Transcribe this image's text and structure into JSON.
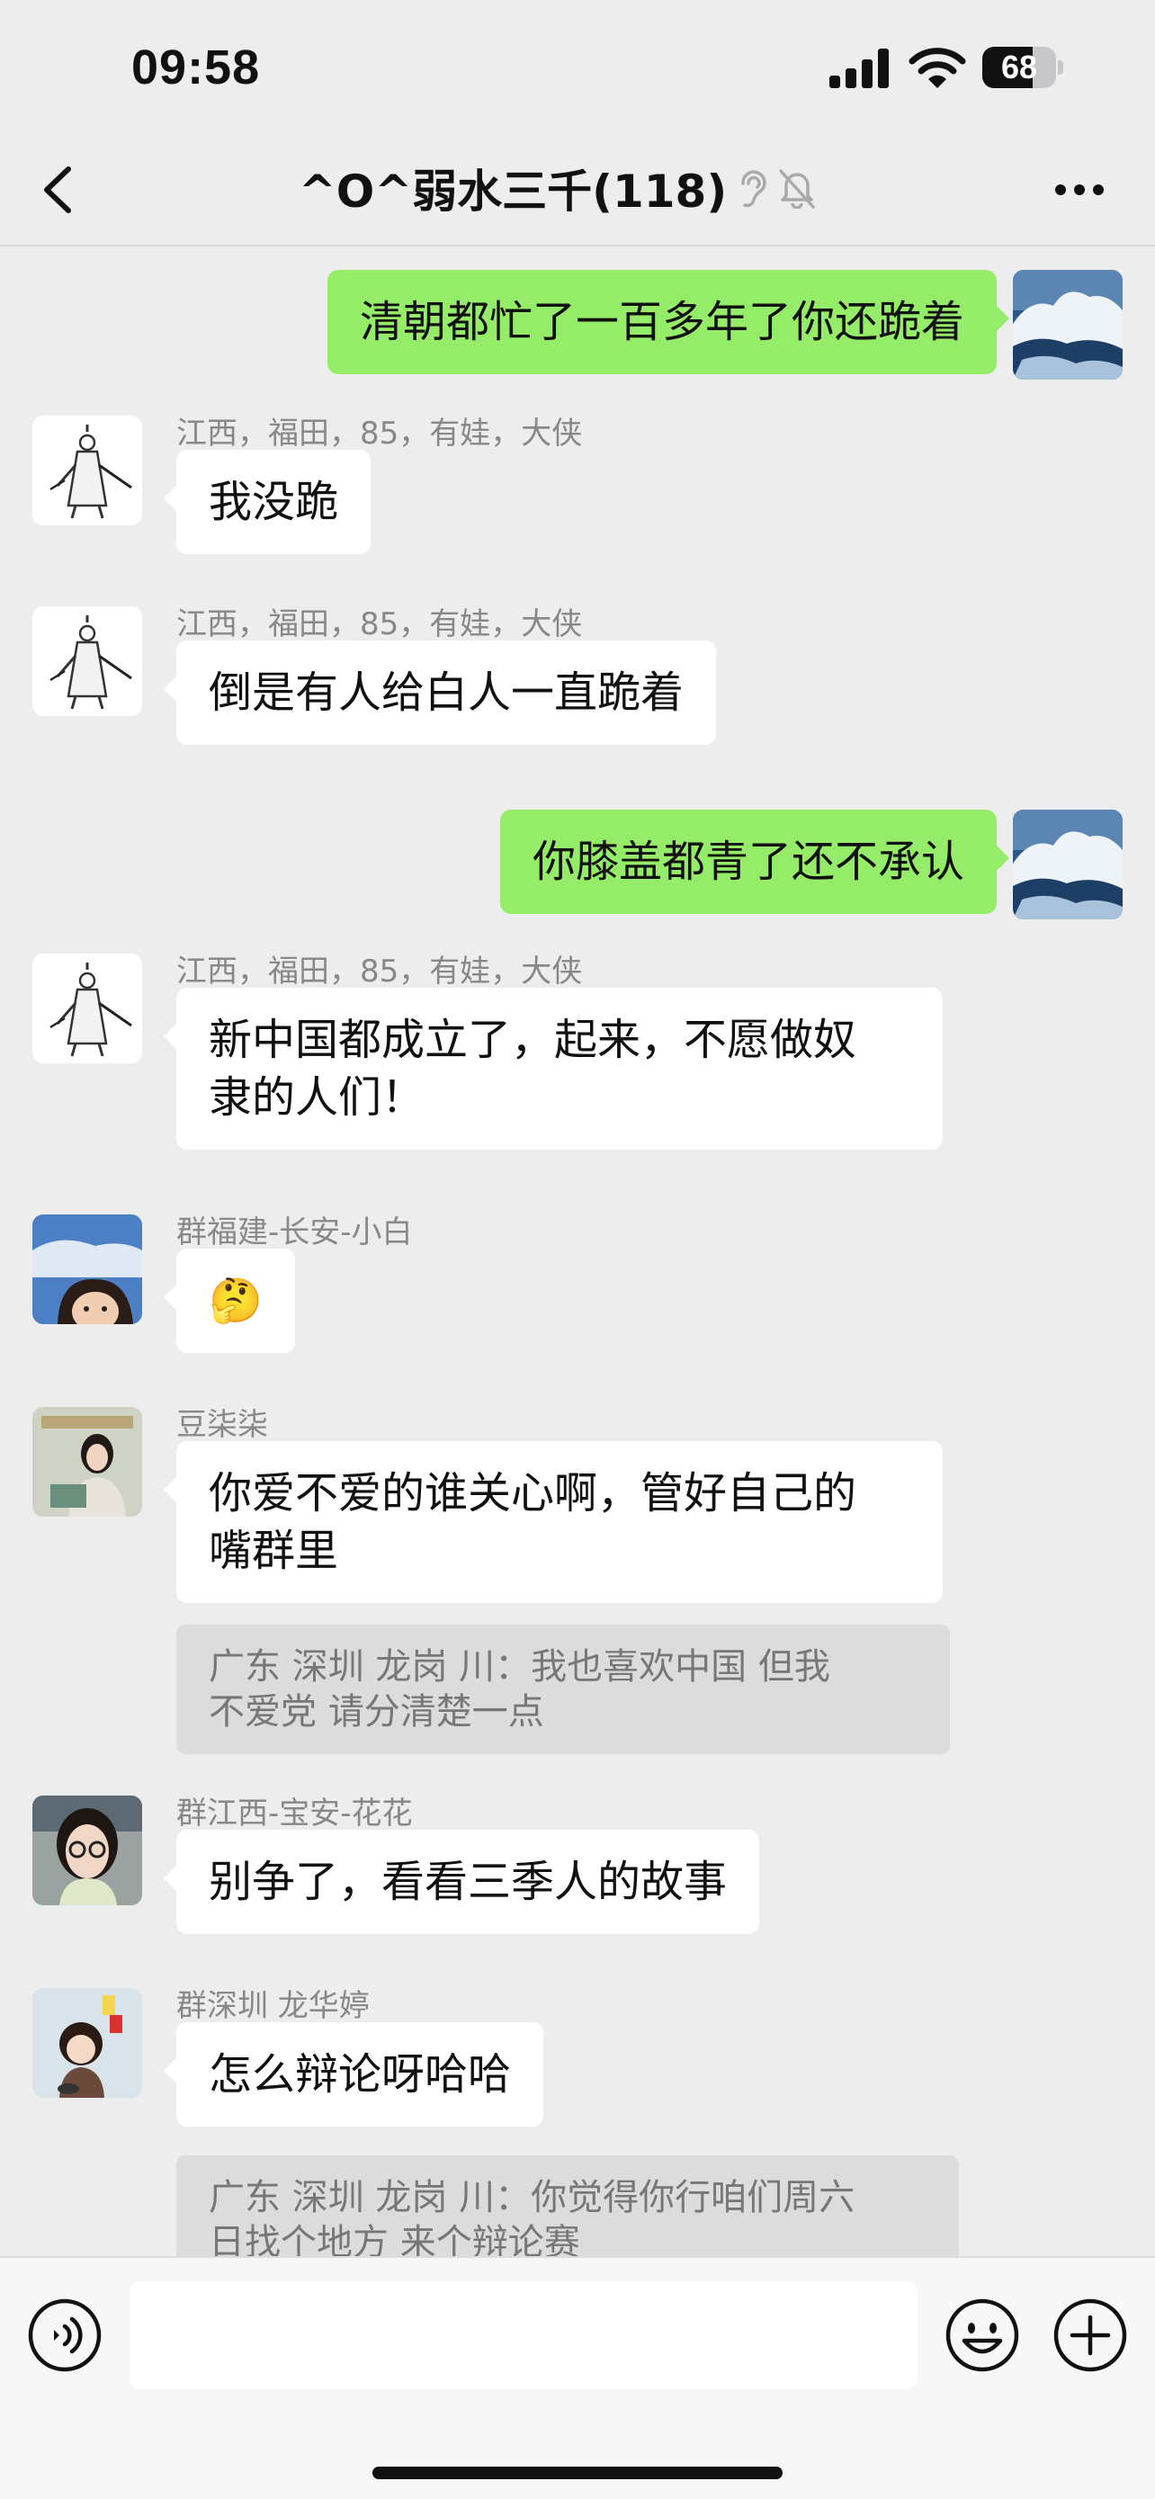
{
  "status_bar": {
    "time": "09:58",
    "battery": "68",
    "battery_level": 0.68
  },
  "header": {
    "title": "^O^弱水三千(118)",
    "icons": [
      "back-icon",
      "earpiece-icon",
      "mute-bell-icon",
      "more-icon"
    ]
  },
  "messages": [
    {
      "side": "out",
      "text": "清朝都忙了一百多年了你还跪着",
      "avatar": "mountain-cloud-avatar"
    },
    {
      "side": "in",
      "sender": "江西，福田，85，有娃，大侠",
      "text": "我没跪",
      "avatar": "swordsman-avatar"
    },
    {
      "side": "in",
      "sender": "江西，福田，85，有娃，大侠",
      "text": "倒是有人给白人一直跪着",
      "avatar": "swordsman-avatar"
    },
    {
      "side": "out",
      "text": "你膝盖都青了还不承认",
      "avatar": "mountain-cloud-avatar"
    },
    {
      "side": "in",
      "sender": "江西，福田，85，有娃，大侠",
      "text_lines": [
        "新中国都成立了，起来，不愿做奴",
        "隶的人们！"
      ],
      "avatar": "swordsman-avatar"
    },
    {
      "side": "in",
      "sender": "群福建-长安-小白",
      "text": "🤔",
      "avatar": "girl-sky-avatar"
    },
    {
      "side": "in",
      "sender": "豆柒柒",
      "text_lines": [
        "你爱不爱的谁关心啊，管好自己的",
        "嘴群里"
      ],
      "avatar": "woman-book-avatar",
      "quote_lines": [
        "广东  深圳  龙岗  川：我也喜欢中国   但我",
        "不爱党   请分清楚一点"
      ]
    },
    {
      "side": "in",
      "sender": "群江西-宝安-花花",
      "text": "别争了，看看三季人的故事",
      "avatar": "woman-glasses-avatar"
    },
    {
      "side": "in",
      "sender": "群深圳 龙华婷",
      "text": "怎么辩论呀哈哈",
      "avatar": "cartoon-girl-avatar",
      "quote_lines": [
        "广东  深圳  龙岗  川：你觉得你行咱们周六",
        "日找个地方  来个辩论赛"
      ]
    }
  ],
  "input_bar": {
    "value": "",
    "icons": [
      "voice-icon",
      "emoji-icon",
      "plus-icon"
    ]
  },
  "colors": {
    "background": "#ededed",
    "outgoing_bubble": "#95ec69",
    "incoming_bubble": "#ffffff",
    "quote_bg": "#dcdcdc",
    "sender_text": "#888888"
  }
}
